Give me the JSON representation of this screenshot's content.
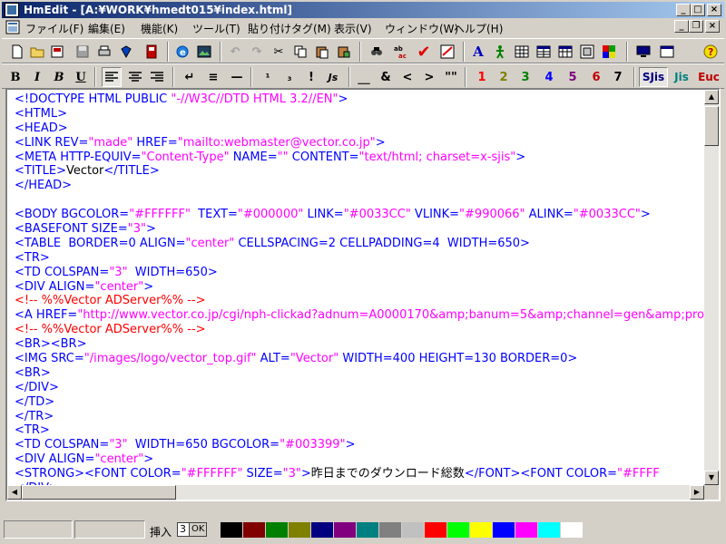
{
  "window": {
    "title": "HmEdit - [A:¥WORK¥hmedt015¥index.html]"
  },
  "menu": [
    "ファイル(F)",
    "編集(E)",
    "機能(K)",
    "ツール(T)",
    "貼り付けタグ(M)",
    "表示(V)",
    "ウィンドウ(W)",
    "ヘルプ(H)"
  ],
  "toolbar1": {
    "icons": [
      "new-file-icon",
      "open-folder-icon",
      "open-recent-icon",
      "save-icon",
      "print-icon",
      "bookmark-icon",
      "close-doc-icon",
      "browser-preview-icon",
      "image-icon",
      "undo-icon",
      "redo-icon",
      "cut-icon",
      "copy-icon",
      "paste-icon",
      "paste-special-icon",
      "find-icon",
      "replace-icon",
      "check-icon",
      "html-check-icon",
      "font-a-icon",
      "person-icon",
      "grid-icon",
      "table-icon",
      "table2-icon",
      "frame-icon",
      "color-icon",
      "monitor-icon",
      "window-icon",
      "help-icon"
    ]
  },
  "toolbar2": {
    "format": [
      "B",
      "I",
      "B",
      "U"
    ],
    "align": [
      "left",
      "center",
      "right"
    ],
    "tags": [
      "↵",
      "≡",
      "—",
      "¹",
      "₃",
      "!",
      "Js",
      "＿",
      "&",
      "<",
      ">",
      "\"\""
    ],
    "numbers": [
      "1",
      "2",
      "3",
      "4",
      "5",
      "6",
      "7"
    ],
    "number_colors": [
      "#ff0000",
      "#808000",
      "#008000",
      "#0000ff",
      "#800080",
      "#c00000",
      "#000000"
    ],
    "encodings": [
      "SJis",
      "Jis",
      "Euc"
    ],
    "encoding_colors": [
      "#000080",
      "#008080",
      "#c00000"
    ],
    "selected_encoding": "SJis"
  },
  "editor": {
    "lines": [
      [
        {
          "t": "tag",
          "s": "<!DOCTYPE HTML PUBLIC "
        },
        {
          "t": "val",
          "s": "\"-//W3C//DTD HTML 3.2//EN\""
        },
        {
          "t": "tag",
          "s": ">"
        }
      ],
      [
        {
          "t": "tag",
          "s": "<HTML>"
        }
      ],
      [
        {
          "t": "tag",
          "s": "<HEAD>"
        }
      ],
      [
        {
          "t": "tag",
          "s": "<LINK REV="
        },
        {
          "t": "val",
          "s": "\"made\""
        },
        {
          "t": "tag",
          "s": " HREF="
        },
        {
          "t": "val",
          "s": "\"mailto:webmaster@vector.co.jp\""
        },
        {
          "t": "tag",
          "s": ">"
        }
      ],
      [
        {
          "t": "tag",
          "s": "<META HTTP-EQUIV="
        },
        {
          "t": "val",
          "s": "\"Content-Type\""
        },
        {
          "t": "tag",
          "s": " NAME="
        },
        {
          "t": "val",
          "s": "\"\""
        },
        {
          "t": "tag",
          "s": " CONTENT="
        },
        {
          "t": "val",
          "s": "\"text/html; charset=x-sjis\""
        },
        {
          "t": "tag",
          "s": ">"
        }
      ],
      [
        {
          "t": "tag",
          "s": "<TITLE>"
        },
        {
          "t": "txt",
          "s": "Vector"
        },
        {
          "t": "tag",
          "s": "</TITLE>"
        }
      ],
      [
        {
          "t": "tag",
          "s": "</HEAD>"
        }
      ],
      [],
      [
        {
          "t": "tag",
          "s": "<BODY BGCOLOR="
        },
        {
          "t": "val",
          "s": "\"#FFFFFF\""
        },
        {
          "t": "tag",
          "s": "  TEXT="
        },
        {
          "t": "val",
          "s": "\"#000000\""
        },
        {
          "t": "tag",
          "s": " LINK="
        },
        {
          "t": "val",
          "s": "\"#0033CC\""
        },
        {
          "t": "tag",
          "s": " VLINK="
        },
        {
          "t": "val",
          "s": "\"#990066\""
        },
        {
          "t": "tag",
          "s": " ALINK="
        },
        {
          "t": "val",
          "s": "\"#0033CC\""
        },
        {
          "t": "tag",
          "s": ">"
        }
      ],
      [
        {
          "t": "tag",
          "s": "<BASEFONT SIZE="
        },
        {
          "t": "val",
          "s": "\"3\""
        },
        {
          "t": "tag",
          "s": ">"
        }
      ],
      [
        {
          "t": "tag",
          "s": "<TABLE  BORDER=0 ALIGN="
        },
        {
          "t": "val",
          "s": "\"center\""
        },
        {
          "t": "tag",
          "s": " CELLSPACING=2 CELLPADDING=4  WIDTH=650>"
        }
      ],
      [
        {
          "t": "tag",
          "s": "<TR>"
        }
      ],
      [
        {
          "t": "tag",
          "s": "<TD COLSPAN="
        },
        {
          "t": "val",
          "s": "\"3\""
        },
        {
          "t": "tag",
          "s": "  WIDTH=650>"
        }
      ],
      [
        {
          "t": "tag",
          "s": "<DIV ALIGN="
        },
        {
          "t": "val",
          "s": "\"center\""
        },
        {
          "t": "tag",
          "s": ">"
        }
      ],
      [
        {
          "t": "cmt",
          "s": "<!-- %%Vector ADServer%% -->"
        }
      ],
      [
        {
          "t": "tag",
          "s": "<A HREF="
        },
        {
          "t": "val",
          "s": "\"http://www.vector.co.jp/cgi/nph-clickad?adnum=A0000170&amp;banum=5&amp;channel=gen&amp;pro"
        }
      ],
      [
        {
          "t": "cmt",
          "s": "<!-- %%Vector ADServer%% -->"
        }
      ],
      [
        {
          "t": "tag",
          "s": "<BR><BR>"
        }
      ],
      [
        {
          "t": "tag",
          "s": "<IMG SRC="
        },
        {
          "t": "val",
          "s": "\"/images/logo/vector_top.gif\""
        },
        {
          "t": "tag",
          "s": " ALT="
        },
        {
          "t": "val",
          "s": "\"Vector\""
        },
        {
          "t": "tag",
          "s": " WIDTH=400 HEIGHT=130 BORDER=0>"
        }
      ],
      [
        {
          "t": "tag",
          "s": "<BR>"
        }
      ],
      [
        {
          "t": "tag",
          "s": "</DIV>"
        }
      ],
      [
        {
          "t": "tag",
          "s": "</TD>"
        }
      ],
      [
        {
          "t": "tag",
          "s": "</TR>"
        }
      ],
      [
        {
          "t": "tag",
          "s": "<TR>"
        }
      ],
      [
        {
          "t": "tag",
          "s": "<TD COLSPAN="
        },
        {
          "t": "val",
          "s": "\"3\""
        },
        {
          "t": "tag",
          "s": "  WIDTH=650 BGCOLOR="
        },
        {
          "t": "val",
          "s": "\"#003399\""
        },
        {
          "t": "tag",
          "s": ">"
        }
      ],
      [
        {
          "t": "tag",
          "s": "<DIV ALIGN="
        },
        {
          "t": "val",
          "s": "\"center\""
        },
        {
          "t": "tag",
          "s": ">"
        }
      ],
      [
        {
          "t": "tag",
          "s": "<STRONG><FONT COLOR="
        },
        {
          "t": "val",
          "s": "\"#FFFFFF\""
        },
        {
          "t": "tag",
          "s": " SIZE="
        },
        {
          "t": "val",
          "s": "\"3\""
        },
        {
          "t": "tag",
          "s": ">"
        },
        {
          "t": "txt",
          "s": "昨日までのダウンロード総数"
        },
        {
          "t": "tag",
          "s": "</FONT><FONT COLOR="
        },
        {
          "t": "val",
          "s": "\"#FFFF"
        }
      ],
      [
        {
          "t": "tag",
          "s": "</DIV>"
        }
      ]
    ]
  },
  "status": {
    "insert_label": "挿入",
    "indent_value": "3",
    "ok_label": "OK",
    "palette": [
      "#000000",
      "#800000",
      "#008000",
      "#808000",
      "#000080",
      "#800080",
      "#008080",
      "#808080",
      "#c0c0c0",
      "#ff0000",
      "#00ff00",
      "#ffff00",
      "#0000ff",
      "#ff00ff",
      "#00ffff",
      "#ffffff"
    ]
  }
}
